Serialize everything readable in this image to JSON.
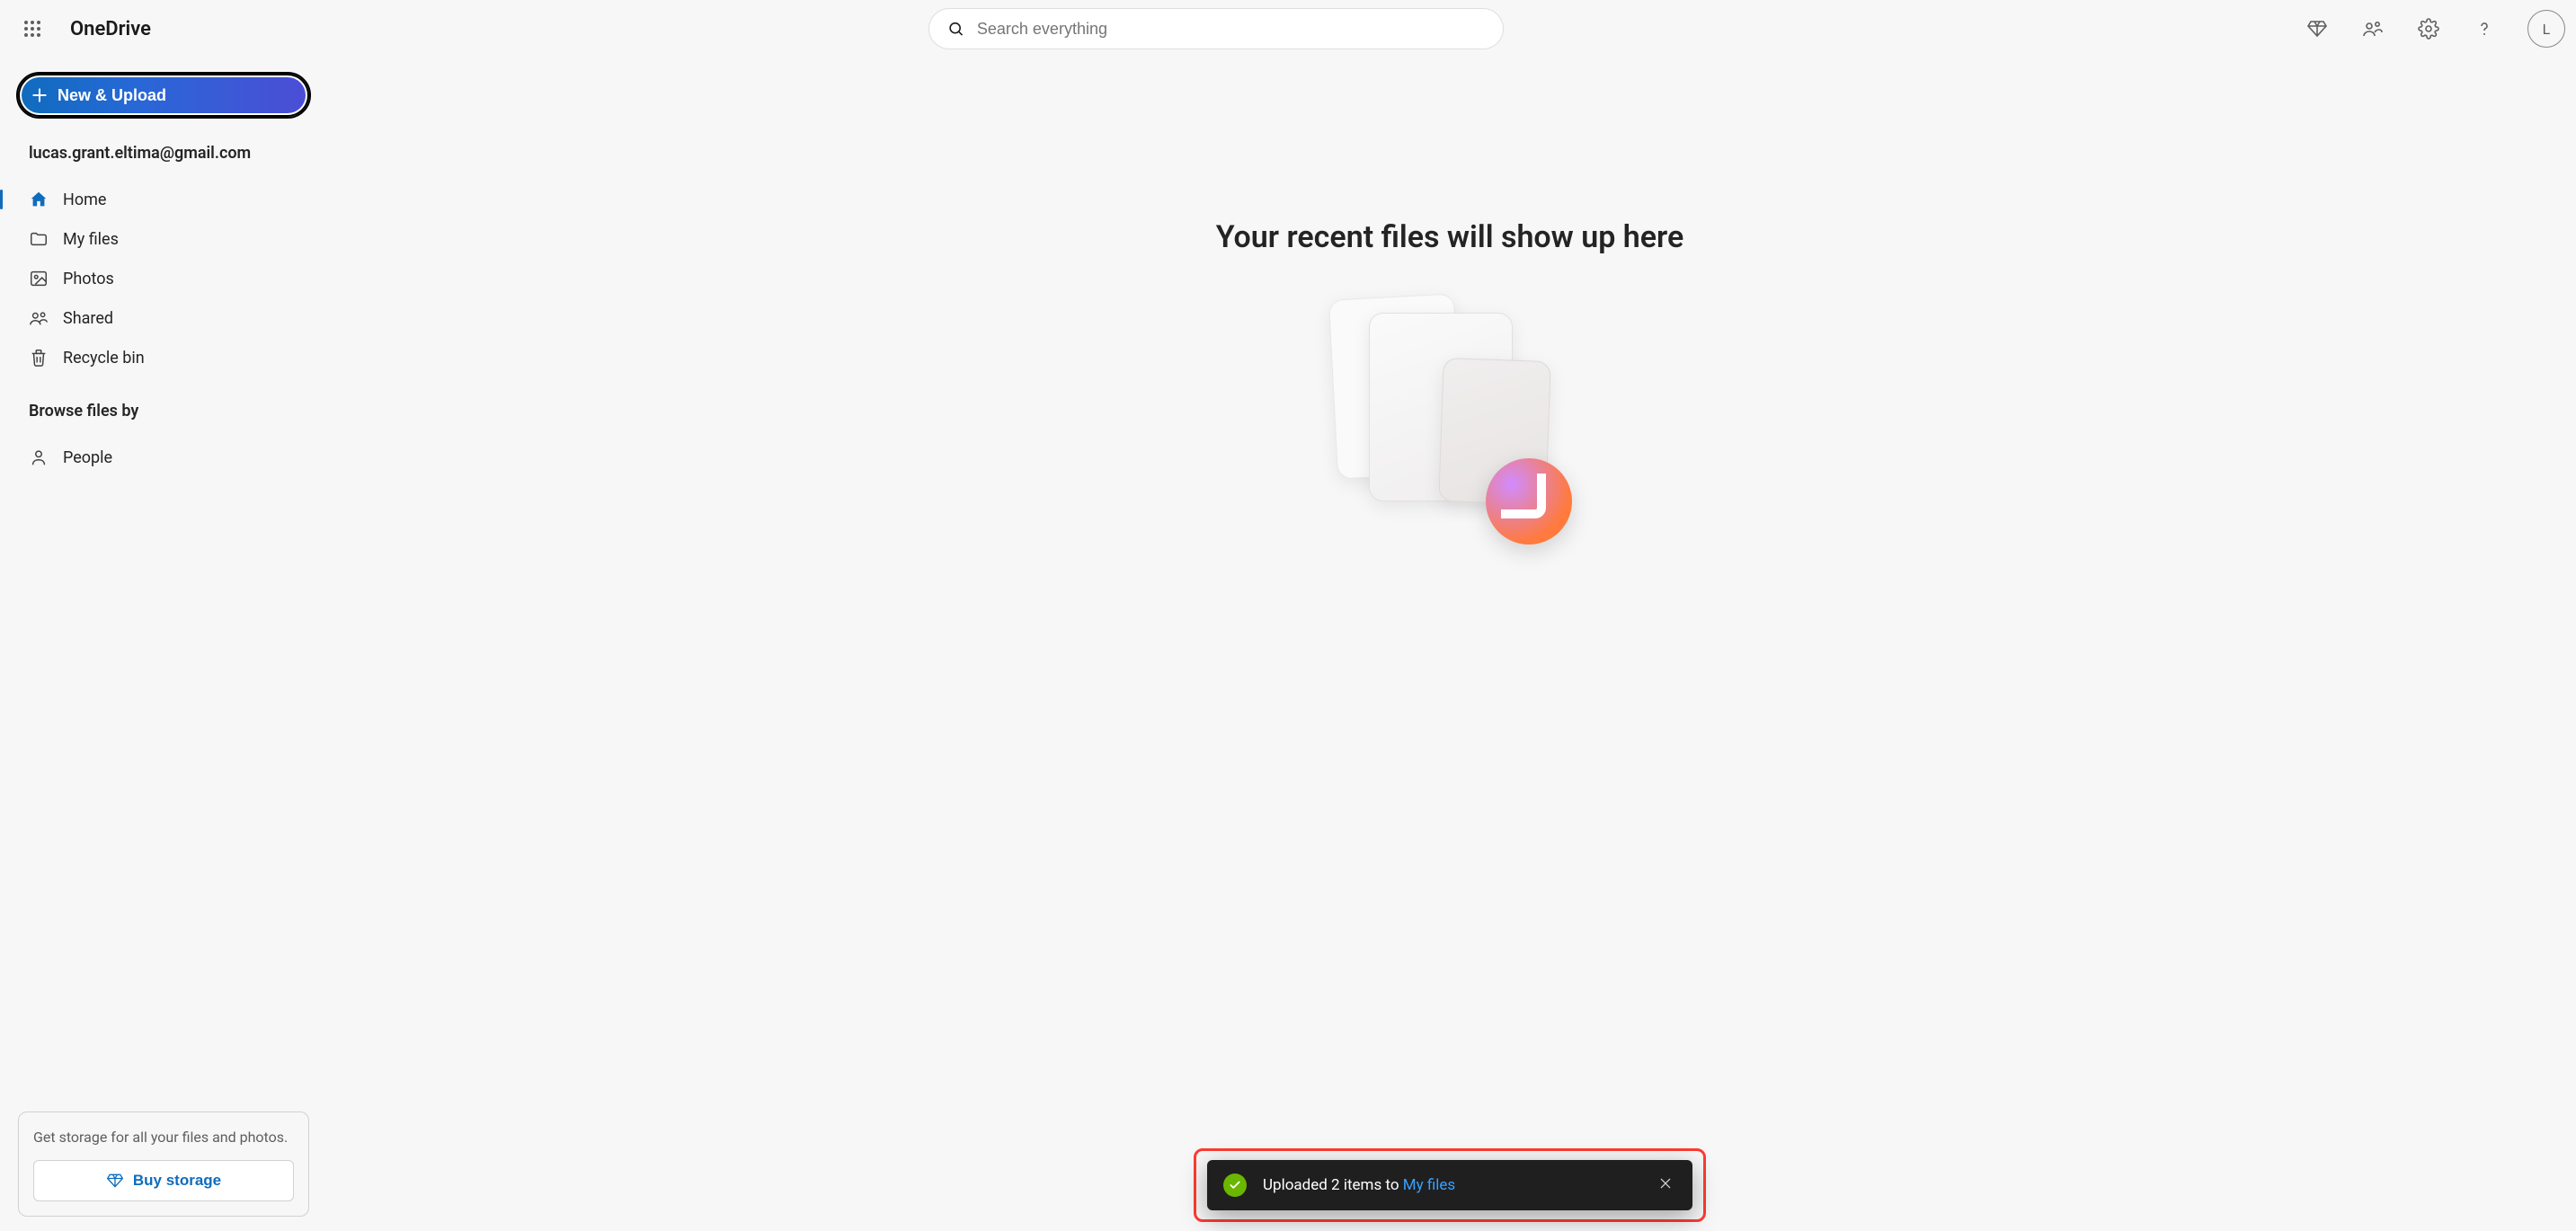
{
  "header": {
    "app_title": "OneDrive",
    "search_placeholder": "Search everything",
    "avatar_initial": "L"
  },
  "sidebar": {
    "new_upload_label": "New & Upload",
    "user_email": "lucas.grant.eltima@gmail.com",
    "nav": [
      {
        "label": "Home"
      },
      {
        "label": "My files"
      },
      {
        "label": "Photos"
      },
      {
        "label": "Shared"
      },
      {
        "label": "Recycle bin"
      }
    ],
    "browse_header": "Browse files by",
    "browse_items": [
      {
        "label": "People"
      }
    ],
    "storage_text": "Get storage for all your files and photos.",
    "buy_storage_label": "Buy storage"
  },
  "main": {
    "empty_title": "Your recent files will show up here"
  },
  "toast": {
    "message_prefix": "Uploaded 2 items to ",
    "link_text": "My files"
  }
}
